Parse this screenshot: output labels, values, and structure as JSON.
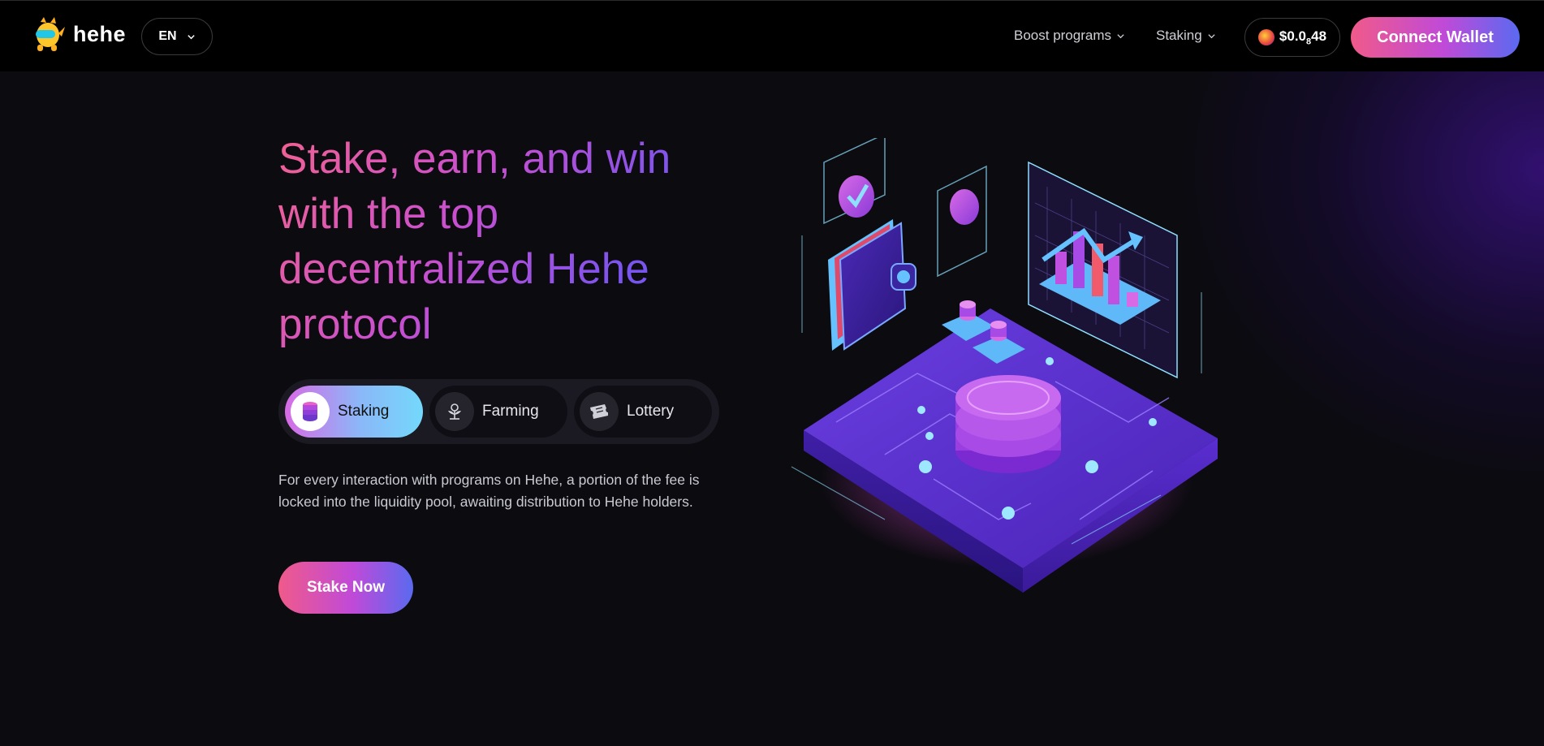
{
  "header": {
    "logo_text": "hehe",
    "language": "EN",
    "nav": [
      {
        "label": "Boost programs"
      },
      {
        "label": "Staking"
      }
    ],
    "price": {
      "prefix": "$0.0",
      "subscript": "8",
      "suffix": "48"
    },
    "connect_label": "Connect Wallet"
  },
  "hero": {
    "title": "Stake, earn, and win with the top decentralized Hehe protocol",
    "tabs": [
      {
        "label": "Staking",
        "icon": "coin-stack-icon",
        "active": true
      },
      {
        "label": "Farming",
        "icon": "plant-icon",
        "active": false
      },
      {
        "label": "Lottery",
        "icon": "ticket-icon",
        "active": false
      }
    ],
    "description": "For every interaction with programs on Hehe, a portion of the fee is locked into the liquidity pool, awaiting distribution to Hehe holders.",
    "cta_label": "Stake Now"
  },
  "colors": {
    "background": "#0c0b10",
    "header_bg": "#000000",
    "accent_pink": "#f05a8a",
    "accent_purple": "#c04ad8",
    "accent_blue": "#5a6af0",
    "glow_purple": "#5014be"
  }
}
